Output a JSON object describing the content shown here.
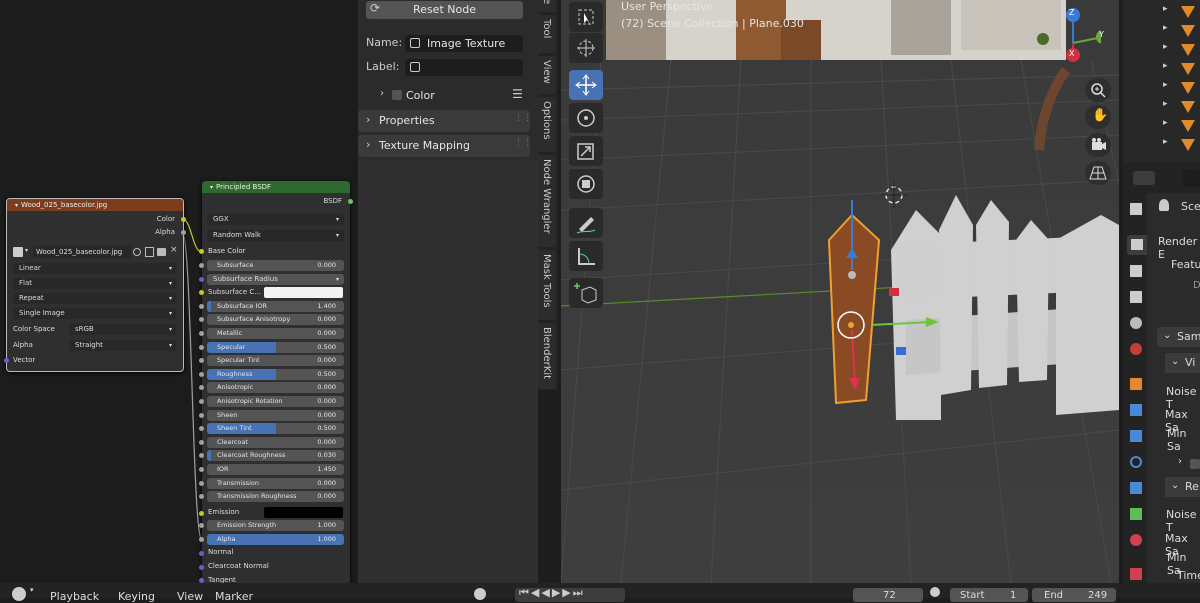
{
  "node_editor": {
    "image_node": {
      "title": "Wood_025_basecolor.jpg",
      "outputs": [
        "Color",
        "Alpha"
      ],
      "image_name": "Wood_025_basecolor.jpg",
      "interpolation": "Linear",
      "projection": "Flat",
      "extension": "Repeat",
      "source": "Single Image",
      "color_space_label": "Color Space",
      "color_space_value": "sRGB",
      "alpha_label": "Alpha",
      "alpha_value": "Straight",
      "input_vector": "Vector"
    },
    "bsdf_node": {
      "title": "Principled BSDF",
      "output": "BSDF",
      "distribution": "GGX",
      "subsurface_method": "Random Walk",
      "base_color_label": "Base Color",
      "subsurface_radius_label": "Subsurface Radius",
      "subsurface_color_label": "Subsurface C...",
      "fields": [
        {
          "label": "Subsurface",
          "value": "0.000",
          "fill": 0
        },
        {
          "label": "Subsurface IOR",
          "value": "1.400",
          "fill": 0.03
        },
        {
          "label": "Subsurface Anisotropy",
          "value": "0.000",
          "fill": 0
        },
        {
          "label": "Metallic",
          "value": "0.000",
          "fill": 0
        },
        {
          "label": "Specular",
          "value": "0.500",
          "fill": 0.5
        },
        {
          "label": "Specular Tint",
          "value": "0.000",
          "fill": 0
        },
        {
          "label": "Roughness",
          "value": "0.500",
          "fill": 0.5
        },
        {
          "label": "Anisotropic",
          "value": "0.000",
          "fill": 0
        },
        {
          "label": "Anisotropic Rotation",
          "value": "0.000",
          "fill": 0
        },
        {
          "label": "Sheen",
          "value": "0.000",
          "fill": 0
        },
        {
          "label": "Sheen Tint",
          "value": "0.500",
          "fill": 0.5
        },
        {
          "label": "Clearcoat",
          "value": "0.000",
          "fill": 0
        },
        {
          "label": "Clearcoat Roughness",
          "value": "0.030",
          "fill": 0.03
        },
        {
          "label": "IOR",
          "value": "1.450",
          "fill": 0
        },
        {
          "label": "Transmission",
          "value": "0.000",
          "fill": 0
        },
        {
          "label": "Transmission Roughness",
          "value": "0.000",
          "fill": 0
        }
      ],
      "emission_label": "Emission",
      "fields2": [
        {
          "label": "Emission Strength",
          "value": "1.000",
          "fill": 0
        },
        {
          "label": "Alpha",
          "value": "1.000",
          "fill": 1
        }
      ],
      "normal_label": "Normal",
      "clearcoat_normal_label": "Clearcoat Normal",
      "tangent_label": "Tangent"
    }
  },
  "side_panel": {
    "reset_node": "Reset Node",
    "name_label": "Name:",
    "name_value": "Image Texture",
    "label_label": "Label:",
    "label_value": "",
    "color_label": "Color",
    "properties_label": "Properties",
    "texture_mapping_label": "Texture Mapping"
  },
  "vertical_tabs": [
    "Tool",
    "View",
    "Options",
    "Node Wrangler",
    "Mask Tools",
    "BlenderKit"
  ],
  "viewport": {
    "perspective": "User Perspective",
    "collection": "(72) Scene Collection | Plane.030",
    "axes": [
      "Z",
      "Y",
      "X"
    ]
  },
  "properties_editor": {
    "scene_label": "Sce",
    "render_label": "Render E",
    "feature_label": "Featu",
    "d_label": "D",
    "sampling_label": "Sam",
    "viewport_label": "Vi",
    "noise_label": "Noise T",
    "max_label": "Max Sa",
    "min_label": "Min Sa",
    "render_section": "Re",
    "noise2_label": "Noise T",
    "max2_label": "Max Sa",
    "min2_label": "Min Sa",
    "time_label": "Time"
  },
  "timeline": {
    "playback": "Playback",
    "keying": "Keying",
    "view": "View",
    "marker": "Marker",
    "current_frame": "72",
    "start_label": "Start",
    "start_value": "1",
    "end_label": "End",
    "end_value": "249"
  },
  "colors": {
    "accent": "#4772b3",
    "image_header": "#7b3d1e",
    "bsdf_header": "#2e6a2e",
    "selection_orange": "#f0a030"
  }
}
